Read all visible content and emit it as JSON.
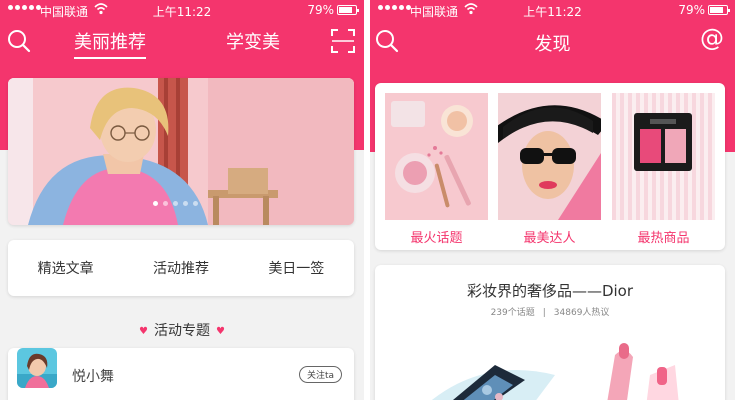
{
  "status_left": {
    "carrier": "中国联通",
    "time": "上午11:22",
    "battery": "79%"
  },
  "status_right": {
    "carrier": "中国联通",
    "time": "上午11:22",
    "battery": "79%"
  },
  "left": {
    "tabs": [
      {
        "label": "美丽推荐",
        "active": true
      },
      {
        "label": "学变美",
        "active": false
      }
    ],
    "icons": {
      "search": "search-icon",
      "scan": "scan-icon"
    },
    "banner": {
      "slide_count": 5,
      "active_index": 0
    },
    "menu": [
      "精选文章",
      "活动推荐",
      "美日一签"
    ],
    "section_title": "活动专题",
    "user": {
      "name": "悦小舞",
      "follow_label": "关注ta"
    }
  },
  "right": {
    "title": "发现",
    "icons": {
      "search": "search-icon",
      "at": "at-icon"
    },
    "topics": [
      {
        "label": "最火话题",
        "image": "cosmetics-flatlay"
      },
      {
        "label": "最美达人",
        "image": "sunglasses-model"
      },
      {
        "label": "最热商品",
        "image": "eyeshadow-palette"
      }
    ],
    "dior": {
      "title": "彩妆界的奢侈品——Dior",
      "topic_count": "239个话题",
      "discussion": "34869人热议"
    }
  },
  "colors": {
    "accent": "#f4356d",
    "background": "#f2f2f2"
  }
}
